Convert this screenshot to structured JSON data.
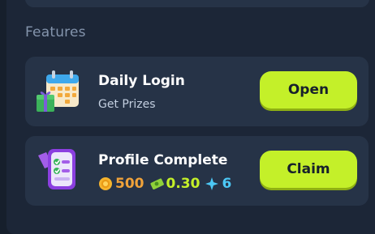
{
  "section_title": "Features",
  "cards": [
    {
      "title": "Daily Login",
      "subtitle": "Get Prizes",
      "button": "Open",
      "icon": "calendar-gift-icon"
    },
    {
      "title": "Profile Complete",
      "button": "Claim",
      "icon": "checklist-icon",
      "rewards": {
        "coins": "500",
        "cash": "0.30",
        "gems": "6"
      }
    }
  ],
  "colors": {
    "accent": "#c4f029",
    "coin": "#f0a23a",
    "cash": "#c4f029",
    "gem": "#4cc8f5"
  }
}
